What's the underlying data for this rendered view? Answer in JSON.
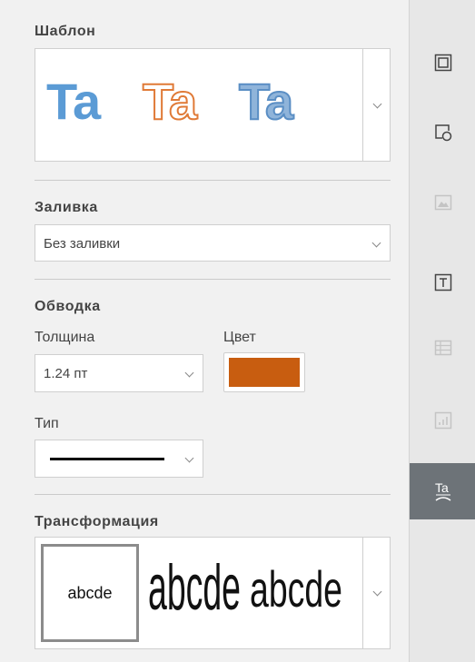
{
  "template": {
    "title": "Шаблон",
    "samples": [
      {
        "text": "Ta",
        "style": "filled-blue",
        "color": "#5b9bd5"
      },
      {
        "text": "Ta",
        "style": "outline-orange",
        "color": "#e07a37"
      },
      {
        "text": "Ta",
        "style": "gradient-blue-outline",
        "color": "#7ea9d3"
      }
    ]
  },
  "fill": {
    "title": "Заливка",
    "value": "Без заливки"
  },
  "stroke": {
    "title": "Обводка",
    "thickness_label": "Толщина",
    "thickness_value": "1.24 пт",
    "color_label": "Цвет",
    "color": "#c85d10",
    "type_label": "Тип"
  },
  "transform": {
    "title": "Трансформация",
    "samples": [
      "abcde",
      "abcde",
      "abcde"
    ]
  },
  "sidebar": {
    "items": [
      {
        "icon": "paragraph-settings-icon",
        "enabled": true,
        "active": false
      },
      {
        "icon": "shape-settings-icon",
        "enabled": true,
        "active": false
      },
      {
        "icon": "image-settings-icon",
        "enabled": false,
        "active": false
      },
      {
        "icon": "text-box-settings-icon",
        "enabled": true,
        "active": false
      },
      {
        "icon": "table-settings-icon",
        "enabled": false,
        "active": false
      },
      {
        "icon": "chart-settings-icon",
        "enabled": false,
        "active": false
      },
      {
        "icon": "text-art-settings-icon",
        "enabled": true,
        "active": true
      }
    ]
  }
}
